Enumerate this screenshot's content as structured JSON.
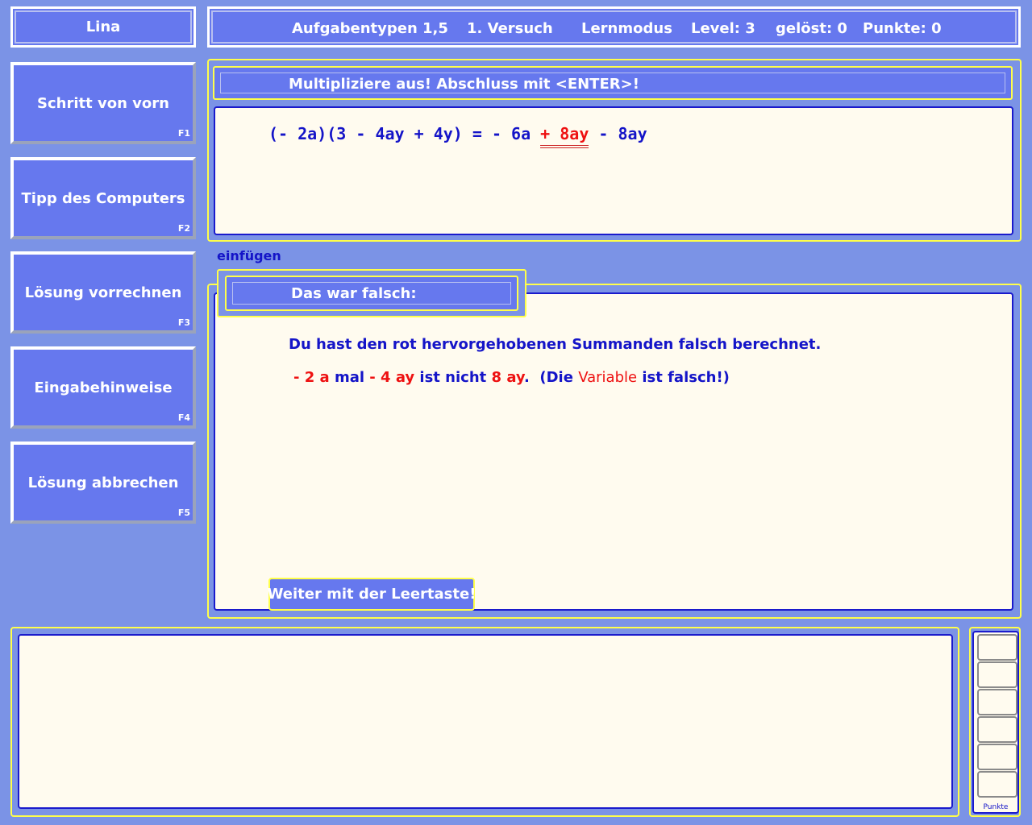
{
  "user": {
    "name": "Lina"
  },
  "status": {
    "task_types": "Aufgabentypen 1,5",
    "attempt": "1. Versuch",
    "mode": "Lernmodus",
    "level": "Level: 3",
    "solved": "gelöst: 0",
    "points": "Punkte: 0"
  },
  "sidebar": {
    "buttons": [
      {
        "label": "Schritt von vorn",
        "key": "F1"
      },
      {
        "label": "Tipp des Computers",
        "key": "F2"
      },
      {
        "label": "Lösung vorrechnen",
        "key": "F3"
      },
      {
        "label": "Eingabehinweise",
        "key": "F4"
      },
      {
        "label": "Lösung abbrechen",
        "key": "F5"
      }
    ]
  },
  "task": {
    "instruction": "Multipliziere aus! Abschluss mit <ENTER>!",
    "expression_left": "(- 2a)(3 - 4ay + 4y) = - 6a ",
    "expression_wrong": "+ 8ay",
    "expression_right": " - 8ay"
  },
  "insert_mode": "einfügen",
  "feedback": {
    "title": "Das war falsch:",
    "line1": "Du hast den rot hervorgehobenen Summanden falsch berechnet.",
    "line2": {
      "factor1": "- 2 a",
      "mal": " mal ",
      "factor2": "- 4 ay",
      "ist_nicht": " ist nicht ",
      "result": "8 ay",
      "dot": ".  (Die ",
      "variable": "Variable",
      "end": " ist falsch!)"
    },
    "continue_label": "Weiter mit der Leertaste!"
  },
  "score_panel": {
    "label": "Punkte",
    "cells": 6
  },
  "colors": {
    "background": "#7b93e6",
    "panel": "#6678ee",
    "frame_yellow": "#ffff4a",
    "text_blue": "#1414c8",
    "text_red": "#ee1111",
    "cream": "#fffbef"
  }
}
